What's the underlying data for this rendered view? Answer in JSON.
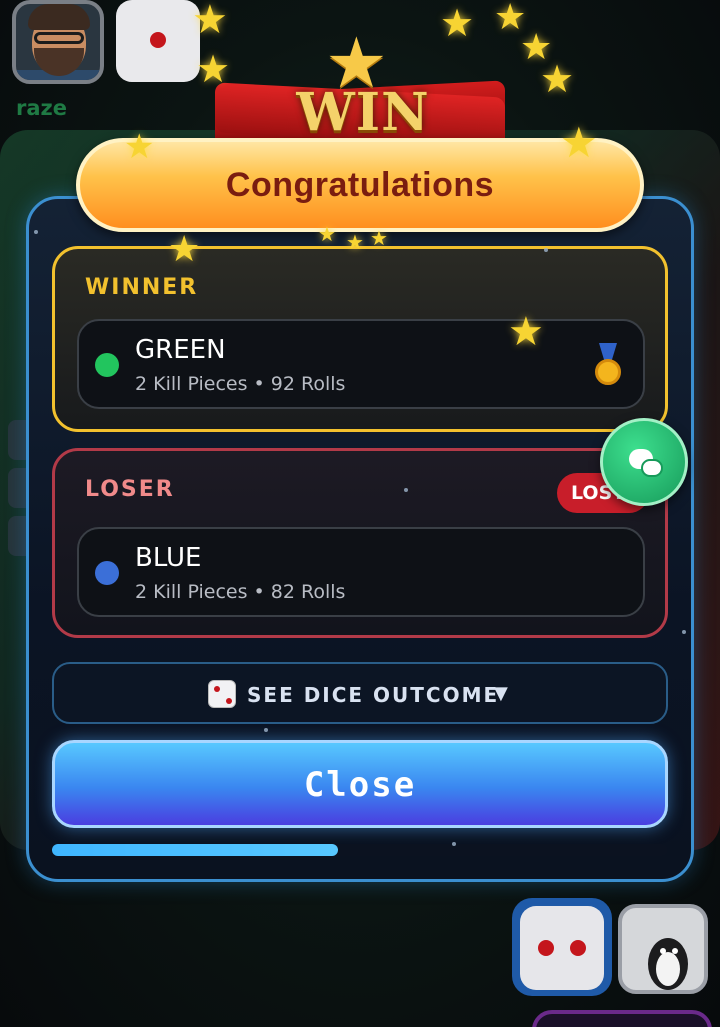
{
  "top_player": {
    "name": "raze",
    "avatar": "bearded-man-avatar",
    "dice_icon": "dice-one-icon"
  },
  "banner": {
    "badge_text": "WIN",
    "title": "Congratulations"
  },
  "winner": {
    "section_title": "WINNER",
    "color_name": "GREEN",
    "color": "#22c55e",
    "stats": "2 Kill Pieces • 92 Rolls",
    "icon": "gold-medal-icon"
  },
  "loser": {
    "section_title": "LOSER",
    "color_name": "BLUE",
    "color": "#3b6fd8",
    "stats": "2 Kill Pieces • 82 Rolls",
    "badge": "LOST"
  },
  "dice_outcome": {
    "icon": "dice-icon",
    "label": "SEE DICE OUTCOME",
    "caret": "▼"
  },
  "close_button": {
    "label": "Close"
  },
  "progress": {
    "fraction": 0.465
  },
  "chat": {
    "icon": "chat-bubbles-icon"
  },
  "colors": {
    "accent_gold": "#f2c12e",
    "loser_red": "#b23a48",
    "modal_border": "#3b8fd0",
    "close_blue": "#3a86f0"
  }
}
